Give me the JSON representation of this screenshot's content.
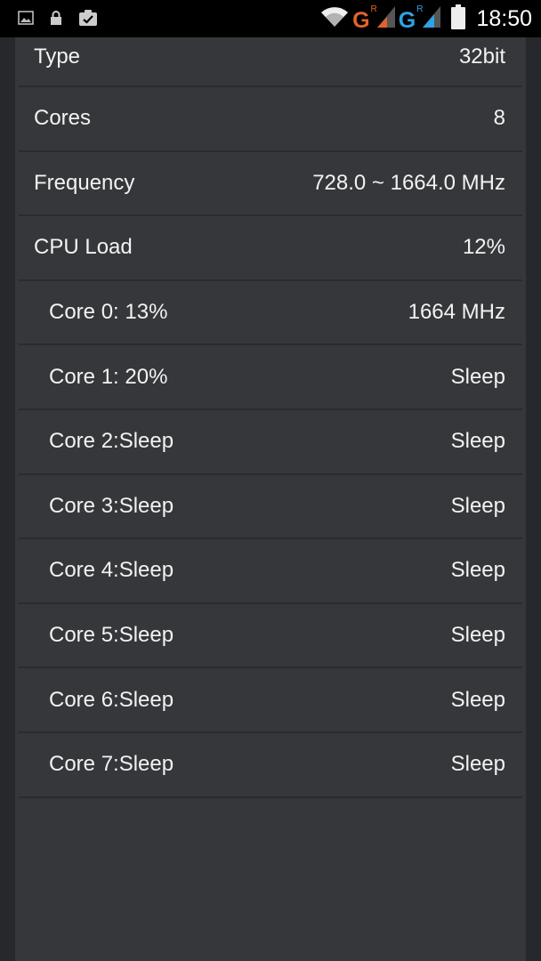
{
  "status_bar": {
    "time": "18:50",
    "network1": {
      "letter": "G",
      "roaming": "R",
      "color": "#e2632a"
    },
    "network2": {
      "letter": "G",
      "roaming": "R",
      "color": "#2ea3e6"
    },
    "icons": [
      "image-icon",
      "lock-icon",
      "clipboard-check-icon",
      "wifi-icon",
      "signal-icon",
      "battery-icon"
    ]
  },
  "cpu_info": {
    "rows": [
      {
        "label": "Type",
        "value": "32bit"
      },
      {
        "label": "Cores",
        "value": "8"
      },
      {
        "label": "Frequency",
        "value": "728.0 ~ 1664.0 MHz"
      },
      {
        "label": "CPU Load",
        "value": "12%"
      }
    ],
    "cores": [
      {
        "label": "Core 0: 13%",
        "value": "1664 MHz"
      },
      {
        "label": "Core 1: 20%",
        "value": "Sleep"
      },
      {
        "label": "Core 2:Sleep",
        "value": "Sleep"
      },
      {
        "label": "Core 3:Sleep",
        "value": "Sleep"
      },
      {
        "label": "Core 4:Sleep",
        "value": "Sleep"
      },
      {
        "label": "Core 5:Sleep",
        "value": "Sleep"
      },
      {
        "label": "Core 6:Sleep",
        "value": "Sleep"
      },
      {
        "label": "Core 7:Sleep",
        "value": "Sleep"
      }
    ]
  }
}
